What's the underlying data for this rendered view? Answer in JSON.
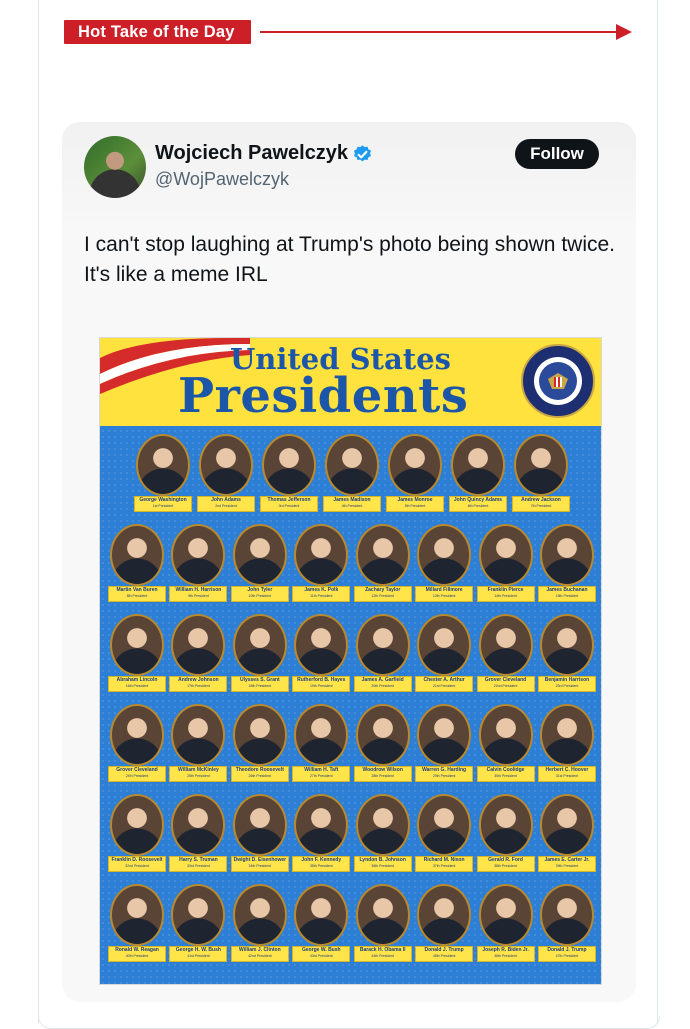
{
  "banner": {
    "label": "Hot Take of the Day",
    "accent": "#cc1f28"
  },
  "tweet": {
    "display_name": "Wojciech Pawelczyk",
    "handle": "@WojPawelczyk",
    "follow_label": "Follow",
    "verified": true,
    "text": "I can't stop laughing at Trump's photo being shown twice. It's like a meme IRL"
  },
  "poster": {
    "title_line1": "United States",
    "title_line2": "Presidents",
    "seal_text": "SEAL OF THE PRESIDENT OF THE UNITED STATES",
    "presidents": [
      [
        "George Washington",
        "1st President"
      ],
      [
        "John Adams",
        "2nd President"
      ],
      [
        "Thomas Jefferson",
        "3rd President"
      ],
      [
        "James Madison",
        "4th President"
      ],
      [
        "James Monroe",
        "5th President"
      ],
      [
        "John Quincy Adams",
        "6th President"
      ],
      [
        "Andrew Jackson",
        "7th President"
      ],
      [
        "Martin Van Buren",
        "8th President"
      ],
      [
        "William H. Harrison",
        "9th President"
      ],
      [
        "John Tyler",
        "10th President"
      ],
      [
        "James K. Polk",
        "11th President"
      ],
      [
        "Zachary Taylor",
        "12th President"
      ],
      [
        "Millard Fillmore",
        "13th President"
      ],
      [
        "Franklin Pierce",
        "14th President"
      ],
      [
        "James Buchanan",
        "15th President"
      ],
      [
        "Abraham Lincoln",
        "16th President"
      ],
      [
        "Andrew Johnson",
        "17th President"
      ],
      [
        "Ulysses S. Grant",
        "18th President"
      ],
      [
        "Rutherford B. Hayes",
        "19th President"
      ],
      [
        "James A. Garfield",
        "20th President"
      ],
      [
        "Chester A. Arthur",
        "21st President"
      ],
      [
        "Grover Cleveland",
        "22nd President"
      ],
      [
        "Benjamin Harrison",
        "23rd President"
      ],
      [
        "Grover Cleveland",
        "24th President"
      ],
      [
        "William McKinley",
        "25th President"
      ],
      [
        "Theodore Roosevelt",
        "26th President"
      ],
      [
        "William H. Taft",
        "27th President"
      ],
      [
        "Woodrow Wilson",
        "28th President"
      ],
      [
        "Warren G. Harding",
        "29th President"
      ],
      [
        "Calvin Coolidge",
        "30th President"
      ],
      [
        "Herbert C. Hoover",
        "31st President"
      ],
      [
        "Franklin D. Roosevelt",
        "32nd President"
      ],
      [
        "Harry S. Truman",
        "33rd President"
      ],
      [
        "Dwight D. Eisenhower",
        "34th President"
      ],
      [
        "John F. Kennedy",
        "35th President"
      ],
      [
        "Lyndon B. Johnson",
        "36th President"
      ],
      [
        "Richard M. Nixon",
        "37th President"
      ],
      [
        "Gerald R. Ford",
        "38th President"
      ],
      [
        "James E. Carter Jr.",
        "39th President"
      ],
      [
        "Ronald W. Reagan",
        "40th President"
      ],
      [
        "George H. W. Bush",
        "41st President"
      ],
      [
        "William J. Clinton",
        "42nd President"
      ],
      [
        "George W. Bush",
        "43rd President"
      ],
      [
        "Barack H. Obama II",
        "44th President"
      ],
      [
        "Donald J. Trump",
        "45th President"
      ],
      [
        "Joseph R. Biden Jr.",
        "46th President"
      ],
      [
        "Donald J. Trump",
        "47th President"
      ]
    ],
    "row_sizes": [
      7,
      8,
      8,
      8,
      8,
      8
    ]
  }
}
